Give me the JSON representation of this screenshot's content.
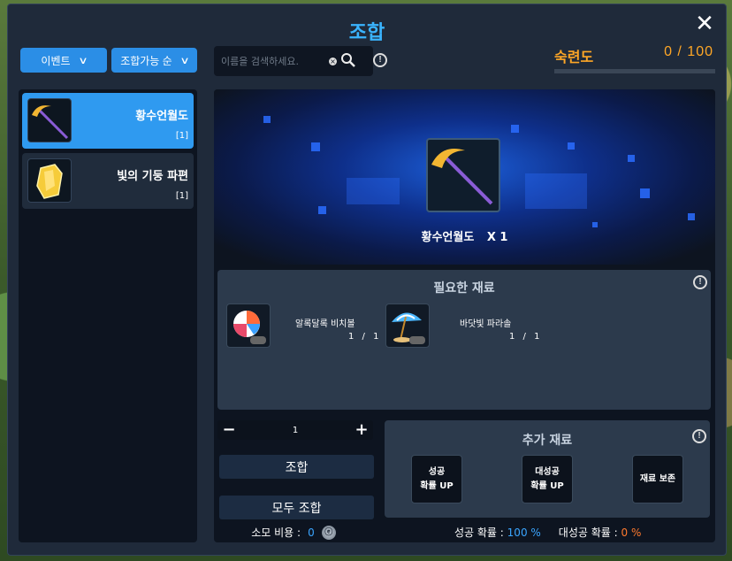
{
  "window": {
    "title": "조합",
    "close_label": "✕"
  },
  "filters": {
    "event_label": "이벤트",
    "sort_label": "조합가능 순"
  },
  "search": {
    "placeholder": "이름을 검색하세요."
  },
  "mastery": {
    "label": "숙련도",
    "value": "0 / 100",
    "progress_fraction": 0.0
  },
  "recipes": [
    {
      "name": "황수언월도",
      "count": "[1]",
      "icon": "golden-pickaxe-icon",
      "selected": true
    },
    {
      "name": "빛의 기둥 파편",
      "count": "[1]",
      "icon": "light-crystal-shard-icon",
      "selected": false
    }
  ],
  "preview": {
    "name": "황수언월도",
    "multiplier": "X 1"
  },
  "materials": {
    "title": "필요한 재료",
    "items": [
      {
        "name": "알록달록 비치볼",
        "owned": "1",
        "required": "1",
        "icon": "beach-ball-icon"
      },
      {
        "name": "바닷빛 파라솔",
        "owned": "1",
        "required": "1",
        "icon": "beach-parasol-icon"
      }
    ]
  },
  "quantity": {
    "minus": "−",
    "value": "1",
    "plus": "+"
  },
  "actions": {
    "craft": "조합",
    "craft_all": "모두 조합"
  },
  "cost": {
    "label": "소모 비용 :",
    "value": "0",
    "icon": "coin-icon"
  },
  "extra": {
    "title": "추가 재료",
    "buttons": [
      {
        "label": "성공\n확률 UP"
      },
      {
        "label": "대성공\n확률 UP"
      },
      {
        "label": "재료 보존"
      }
    ]
  },
  "rates": {
    "success_label": "성공 확률 :",
    "success_value": "100 %",
    "great_label": "대성공 확률 :",
    "great_value": "0 %"
  },
  "colors": {
    "accent": "#3ab4ff",
    "selected_item": "#2f9af0",
    "mastery": "#ffa726",
    "great_success": "#ff7a2e"
  }
}
